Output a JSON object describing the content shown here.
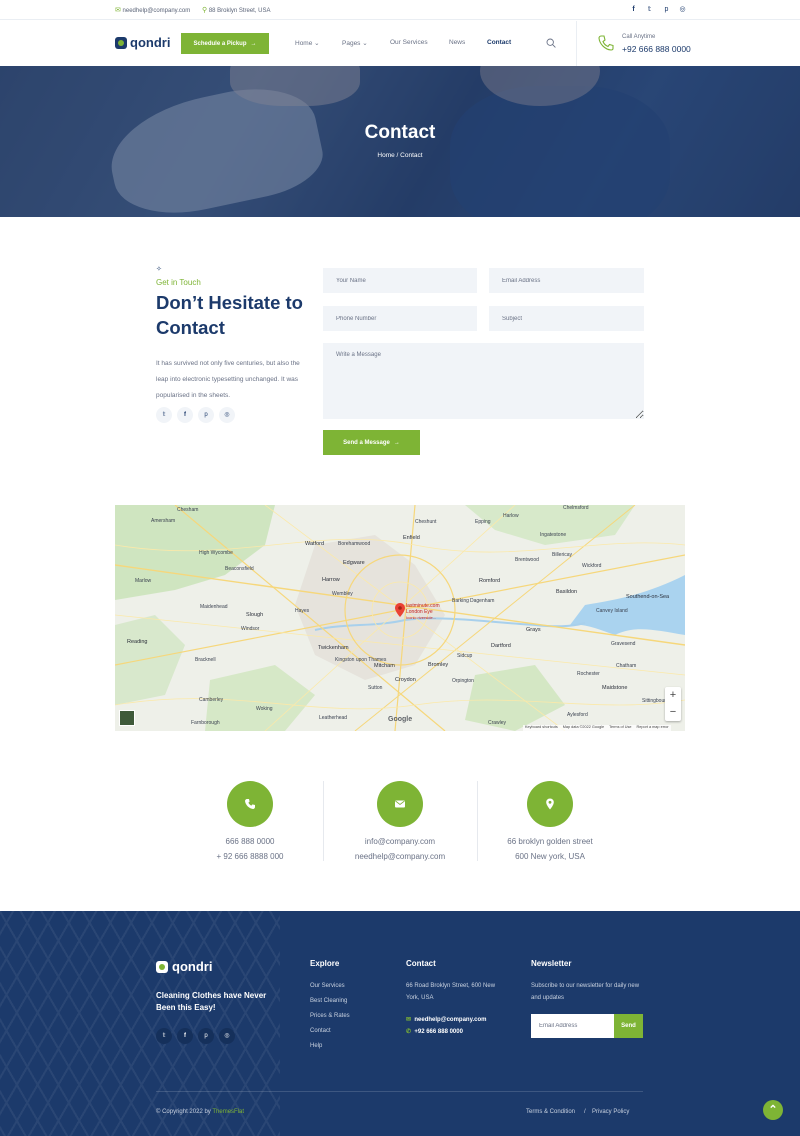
{
  "topbar": {
    "email": "needhelp@company.com",
    "address": "88 Broklyn Street, USA",
    "socials": [
      "facebook-icon",
      "twitter-icon",
      "pinterest-icon",
      "instagram-icon"
    ]
  },
  "header": {
    "logo_text": "qondri",
    "cta_label": "Schedule a Pickup",
    "cta_arrow": "→",
    "nav": [
      {
        "label": "Home",
        "dropdown": "⌄"
      },
      {
        "label": "Pages",
        "dropdown": "⌄"
      },
      {
        "label": "Our Services"
      },
      {
        "label": "News"
      },
      {
        "label": "Contact",
        "active": true
      }
    ],
    "call_label": "Call Anytime",
    "call_number": "+92 666 888 0000"
  },
  "hero": {
    "title": "Contact",
    "breadcrumb": "Home  /  Contact"
  },
  "contact": {
    "sparkle": "✧",
    "eyebrow": "Get in Touch",
    "headline": "Don’t Hesitate to Contact",
    "intro": "It has survived not only five centuries, but also the leap into electronic typesetting unchanged. It was popularised in the sheets.",
    "socials": [
      {
        "icon": "twitter-icon",
        "glyph": "𝕥"
      },
      {
        "icon": "facebook-icon",
        "glyph": "f"
      },
      {
        "icon": "pinterest-icon",
        "glyph": "p"
      },
      {
        "icon": "instagram-icon",
        "glyph": "◎"
      }
    ],
    "form": {
      "name_placeholder": "Your Name",
      "email_placeholder": "Email Address",
      "phone_placeholder": "Phone Number",
      "subject_placeholder": "Subject",
      "message_placeholder": "Write a Message",
      "submit_label": "Send a Message",
      "submit_arrow": "→"
    }
  },
  "map": {
    "pin_label_1": "lastminute.com",
    "pin_label_2": "London Eye",
    "pin_label_3": "Iconic riverside...",
    "places": [
      "Chesham",
      "Amersham",
      "Watford",
      "Borehamwood",
      "Enfield",
      "Cheshunt",
      "Epping",
      "Harlow",
      "Chelmsford",
      "High Wycombe",
      "Beaconsfield",
      "Edgware",
      "Brentwood",
      "Ingatestone",
      "Billericay",
      "Wickford",
      "Marlow",
      "Harrow",
      "Romford",
      "Basildon",
      "Southend-on-Sea",
      "Maidenhead",
      "Slough",
      "Wembley",
      "Barking",
      "Dagenham",
      "Canvey Island",
      "Reading",
      "Windsor",
      "Hayes",
      "Twickenham",
      "Grays",
      "Bracknell",
      "Kingston upon Thames",
      "Dartford",
      "Gravesend",
      "Mitcham",
      "Bromley",
      "Chatham",
      "Sidcup",
      "Croydon",
      "Sutton",
      "Orpington",
      "Rochester",
      "Woking",
      "Leatherhead",
      "Sittingbourne",
      "Farnborough",
      "Camberley",
      "Crawley",
      "Maidstone",
      "Aylesford"
    ],
    "zoom_in": "+",
    "zoom_out": "−",
    "google": "Google",
    "attrib": [
      "Keyboard shortcuts",
      "Map data ©2022 Google",
      "Terms of Use",
      "Report a map error"
    ]
  },
  "info": {
    "phone_1": "666 888 0000",
    "phone_2": "+ 92 666 8888 000",
    "email_1": "info@company.com",
    "email_2": "needhelp@company.com",
    "addr_1": "66 broklyn golden street",
    "addr_2": "600 New york, USA"
  },
  "footer": {
    "logo_text": "qondri",
    "tagline": "Cleaning Clothes have Never Been this Easy!",
    "socials": [
      {
        "icon": "twitter-icon",
        "glyph": "𝕥"
      },
      {
        "icon": "facebook-icon",
        "glyph": "f"
      },
      {
        "icon": "pinterest-icon",
        "glyph": "p"
      },
      {
        "icon": "instagram-icon",
        "glyph": "◎"
      }
    ],
    "explore_title": "Explore",
    "explore_links": [
      "Our Services",
      "Best Cleaning",
      "Prices & Rates",
      "Contact",
      "Help"
    ],
    "contact_title": "Contact",
    "contact_address": "66 Road Broklyn Street, 600 New York, USA",
    "contact_email": "needhelp@company.com",
    "contact_phone": "+92 666 888 0000",
    "newsletter_title": "Newsletter",
    "newsletter_text": "Subscribe to our newsletter for daily new and updates",
    "newsletter_placeholder": "Email Address",
    "newsletter_button": "Send",
    "copyright_prefix": "© Copyright 2022 by",
    "copyright_brand": "ThemesFlat",
    "terms": "Terms & Condition",
    "separator": "/",
    "privacy": "Privacy Policy",
    "to_top": "⌃"
  },
  "colors": {
    "navy": "#1c3a6b",
    "green": "#7eb435",
    "field_bg": "#f1f4f8",
    "muted_text": "#6a7286"
  }
}
